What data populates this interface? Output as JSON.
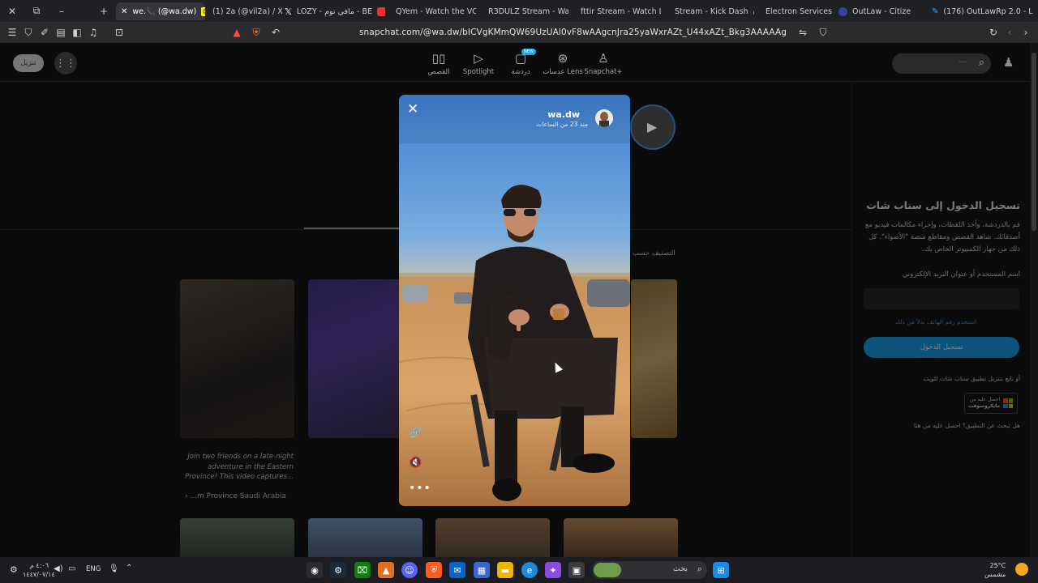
{
  "browser": {
    "tabs": [
      {
        "title": "we.📞 (@wa.dw)",
        "active": true,
        "favicon_color": "#fffc00"
      },
      {
        "title": "(1) 2a (@vil2a) / X",
        "favicon_color": "#000000"
      },
      {
        "title": "LOZY - مافي نوم - BE",
        "favicon_color": "#ff2a2a"
      },
      {
        "title": "QYem - Watch the VO",
        "favicon_color": "#53fc18"
      },
      {
        "title": "R3DULZ Stream - Watc",
        "favicon_color": "#53fc18"
      },
      {
        "title": "fttir Stream - Watch Li",
        "favicon_color": "#53fc18"
      },
      {
        "title": "Stream - Kick Dash",
        "favicon_color": "#53fc18"
      },
      {
        "title": "Electron Services",
        "favicon_color": "#4a8cf0"
      },
      {
        "title": "OutLaw - Citizen",
        "favicon_color": "#3a3f9e"
      },
      {
        "title": "(176) OutLawRp 2.0 - L",
        "favicon_color": "#3fa4ff"
      }
    ],
    "url": "snapchat.com/@wa.dw/bICVgKMmQW69UzUAl0vF8wAAgcnJra25yaWxrAZt_U44xAZt_Bkg3AAAAAg"
  },
  "snap_nav": {
    "items": [
      {
        "label": "القصص",
        "icon": "stories-icon"
      },
      {
        "label": "Spotlight",
        "icon": "play-icon"
      },
      {
        "label": "دردشة",
        "icon": "chat-icon",
        "badge": "NEW"
      },
      {
        "label": "عدسات Lens",
        "icon": "lens-icon"
      },
      {
        "label": "Snapchat+",
        "icon": "ghost-plus-icon"
      }
    ],
    "download_label": "تنزيل",
    "search_placeholder": "—"
  },
  "viewer": {
    "username": "wa.dw",
    "time": "منذ 23 من الساعات"
  },
  "feed": {
    "sort_label": "التصنيف حسب",
    "caption": "Join two friends on a late-night adventure in the Eastern Province! This video captures...",
    "location": "...m Province Saudi Arabia"
  },
  "login_panel": {
    "title": "تسجيل الدخول إلى سناب شات",
    "description": "قم بالدردشة، وأخذ اللقطات، وإجراء مكالمات فيديو مع أصدقائك. شاهد القصص ومقاطع منصة \"الأضواء\". كل ذلك من جهاز الكمبيوتر الخاص بك.",
    "username_label": "اسم المستخدم أو عنوان البريد الإلكتروني",
    "phone_link": "استخدم رقم الهاتف بدلاً من ذلك",
    "login_button": "تسجيل الدخول",
    "or_download": "أو تابع بتنزيل تطبيق سناب شات للويب",
    "ms_badge_top": "احصل عليه من",
    "ms_badge_bottom": "مايكروسوفت",
    "help_text": "هل تبحث عن التطبيق؟ احصل عليه من هنا"
  },
  "taskbar": {
    "search_text": "بحث",
    "weather_temp": "25°C",
    "weather_desc": "مشمس",
    "language": "ENG",
    "time": "٤:٠٦ م",
    "date": "١٤٤٧/٠٧/١٤"
  }
}
